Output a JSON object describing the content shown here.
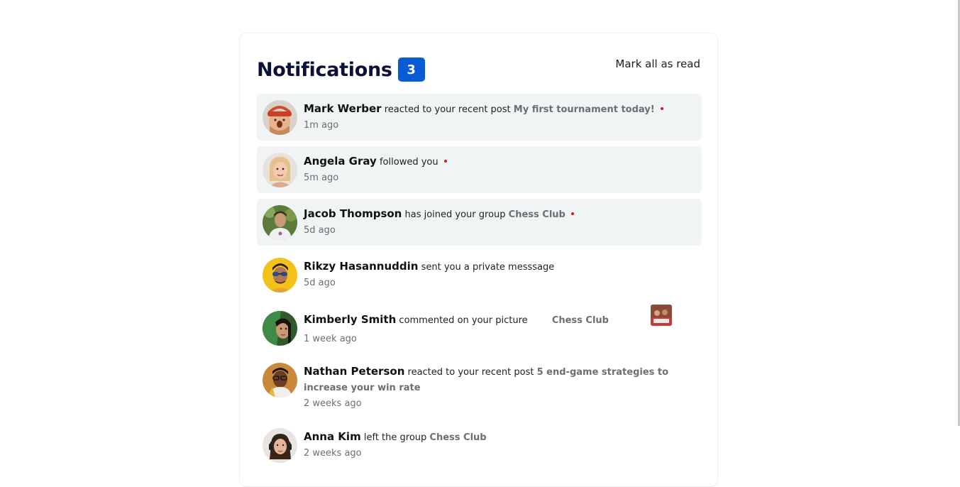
{
  "header": {
    "title": "Notifications",
    "unread_count": "3",
    "mark_all_label": "Mark all as read"
  },
  "notifications": [
    {
      "name": "Mark Werber",
      "action": "reacted to your recent post",
      "target": "My first tournament today!",
      "time": "1m ago",
      "unread": true
    },
    {
      "name": "Angela Gray",
      "action": "followed you",
      "target": "",
      "time": "5m ago",
      "unread": true
    },
    {
      "name": "Jacob Thompson",
      "action": "has joined your group",
      "target": "Chess Club",
      "time": "5d ago",
      "unread": true
    },
    {
      "name": "Rikzy Hasannuddin",
      "action": "sent you a private messsage",
      "target": "",
      "time": "5d ago",
      "unread": false
    },
    {
      "name": "Kimberly Smith",
      "action": "commented on your picture",
      "target": "Chess Club",
      "time": "1 week ago",
      "unread": false
    },
    {
      "name": "Nathan Peterson",
      "action": "reacted to your recent post",
      "target": "5 end-game strategies to increase your win rate",
      "time": "2 weeks ago",
      "unread": false
    },
    {
      "name": "Anna Kim",
      "action": "left the group",
      "target": "Chess Club",
      "time": "2 weeks ago",
      "unread": false
    }
  ],
  "colors": {
    "title": "#0b1137",
    "badge": "#0a5bd6",
    "unread_bg": "#f1f4f5",
    "unread_dot": "#e0141e",
    "muted_text": "#6b6f72"
  }
}
